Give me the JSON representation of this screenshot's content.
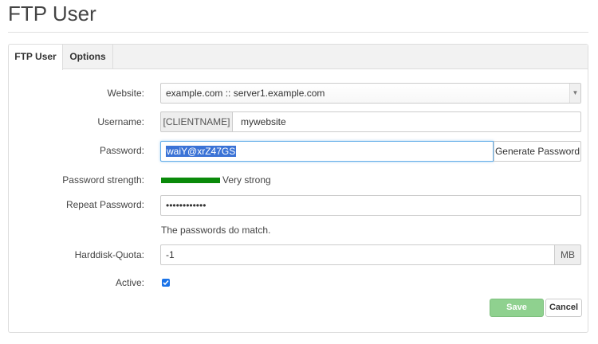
{
  "page": {
    "title": "FTP User"
  },
  "tabs": [
    {
      "label": "FTP User"
    },
    {
      "label": "Options"
    }
  ],
  "form": {
    "website": {
      "label": "Website:",
      "value": "example.com :: server1.example.com",
      "arrow_icon": "triangle-down"
    },
    "username": {
      "label": "Username:",
      "prefix": "[CLIENTNAME]",
      "value": "mywebsite"
    },
    "password": {
      "label": "Password:",
      "value": "waiY@xrZ47GS",
      "generate_label": "Generate Password"
    },
    "strength": {
      "label": "Password strength:",
      "text": "Very strong",
      "level_percent": 100,
      "color": "#0a8a0a"
    },
    "repeat_password": {
      "label": "Repeat Password:",
      "masked_value": "••••••••••••"
    },
    "match_message": "The passwords do match.",
    "quota": {
      "label": "Harddisk-Quota:",
      "value": "-1",
      "unit": "MB"
    },
    "active": {
      "label": "Active:",
      "checked": true,
      "color": "#1a73e8"
    }
  },
  "actions": {
    "save_label": "Save",
    "save_color": "#8fd18f",
    "cancel_label": "Cancel"
  }
}
